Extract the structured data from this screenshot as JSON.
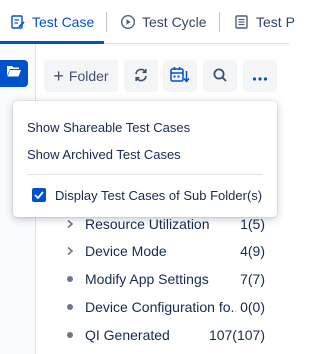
{
  "tabs": [
    {
      "label": "Test Case",
      "active": true
    },
    {
      "label": "Test Cycle",
      "active": false
    },
    {
      "label": "Test P",
      "active": false
    }
  ],
  "toolbar": {
    "folder_label": "Folder",
    "icons": [
      "sync-icon",
      "calendar-sort-icon",
      "search-icon",
      "more-icon"
    ]
  },
  "menu": {
    "items": [
      "Show Shareable Test Cases",
      "Show Archived Test Cases"
    ],
    "checkbox_label": "Display Test Cases of Sub Folder(s)",
    "checkbox_checked": true
  },
  "tree": {
    "items": [
      {
        "label": "Resource Utilization",
        "count": "1(5)",
        "type": "expandable"
      },
      {
        "label": "Device Mode",
        "count": "4(9)",
        "type": "expandable"
      },
      {
        "label": "Modify App Settings",
        "count": "7(7)",
        "type": "leaf"
      },
      {
        "label": "Device Configuration fo...",
        "count": "0(0)",
        "type": "leaf"
      },
      {
        "label": "QI Generated",
        "count": "107(107)",
        "type": "leaf"
      }
    ]
  },
  "colors": {
    "accent": "#0052cc",
    "text": "#172b4d",
    "muted": "#6b778c"
  }
}
